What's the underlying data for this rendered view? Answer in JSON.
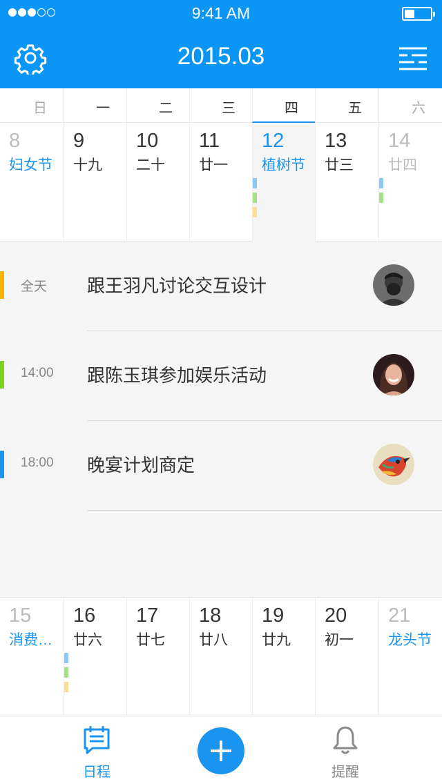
{
  "status_bar": {
    "time": "9:41 AM",
    "signal_dots": 5,
    "signal_filled": 3,
    "battery_level": 0.35
  },
  "header": {
    "title": "2015.03",
    "settings_icon": "gear-icon",
    "menu_icon": "filter-list-icon",
    "color": "#0b95f4"
  },
  "weekdays": [
    "日",
    "一",
    "二",
    "三",
    "四",
    "五",
    "六"
  ],
  "week1": [
    {
      "num": "8",
      "lunar": "妇女节",
      "holiday": true,
      "muted": true,
      "marks": []
    },
    {
      "num": "9",
      "lunar": "十九",
      "holiday": false,
      "muted": false,
      "marks": []
    },
    {
      "num": "10",
      "lunar": "二十",
      "holiday": false,
      "muted": false,
      "marks": []
    },
    {
      "num": "11",
      "lunar": "廿一",
      "holiday": false,
      "muted": false,
      "marks": []
    },
    {
      "num": "12",
      "lunar": "植树节",
      "holiday": true,
      "muted": false,
      "selected": true,
      "marks": [
        "#8cc8f3",
        "#a7e08a",
        "#f7df94"
      ]
    },
    {
      "num": "13",
      "lunar": "廿三",
      "holiday": false,
      "muted": false,
      "marks": []
    },
    {
      "num": "14",
      "lunar": "廿四",
      "holiday": false,
      "muted": true,
      "marks": [
        "#8cc8f3",
        "#a7e08a"
      ]
    }
  ],
  "events": [
    {
      "time": "全天",
      "title": "跟王羽凡讨论交互设计",
      "color": "#f7b500",
      "avatar": "avatar-bearded-man"
    },
    {
      "time": "14:00",
      "title": "跟陈玉琪参加娱乐活动",
      "color": "#7ed321",
      "avatar": "avatar-smiling-woman"
    },
    {
      "time": "18:00",
      "title": "晚宴计划商定",
      "color": "#1a94f1",
      "avatar": "avatar-colorful-bird"
    }
  ],
  "week2": [
    {
      "num": "15",
      "lunar": "消费…",
      "holiday": true,
      "muted": true,
      "marks": []
    },
    {
      "num": "16",
      "lunar": "廿六",
      "holiday": false,
      "muted": false,
      "marks": [
        "#8cc8f3",
        "#a7e08a",
        "#f7df94"
      ]
    },
    {
      "num": "17",
      "lunar": "廿七",
      "holiday": false,
      "muted": false,
      "marks": []
    },
    {
      "num": "18",
      "lunar": "廿八",
      "holiday": false,
      "muted": false,
      "marks": []
    },
    {
      "num": "19",
      "lunar": "廿九",
      "holiday": false,
      "muted": false,
      "marks": []
    },
    {
      "num": "20",
      "lunar": "初一",
      "holiday": false,
      "muted": false,
      "marks": []
    },
    {
      "num": "21",
      "lunar": "龙头节",
      "holiday": true,
      "muted": true,
      "marks": []
    }
  ],
  "tabbar": {
    "schedule_label": "日程",
    "schedule_icon": "calendar-list-icon",
    "add_icon": "plus-icon",
    "reminder_label": "提醒",
    "reminder_icon": "bell-icon"
  },
  "colors": {
    "accent": "#1a94f1",
    "muted": "#bcbcbc"
  }
}
